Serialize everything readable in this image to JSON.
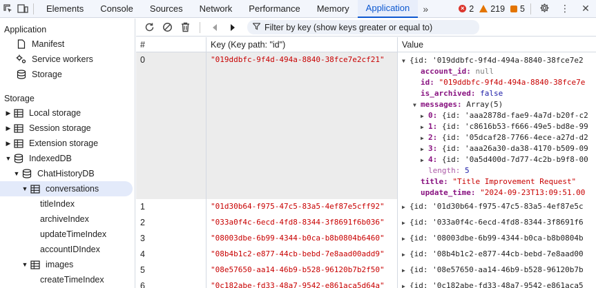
{
  "topbar": {
    "tabs": [
      "Elements",
      "Console",
      "Sources",
      "Network",
      "Performance",
      "Memory",
      "Application"
    ],
    "active_tab": "Application",
    "errors": "2",
    "warnings": "219",
    "issues": "5"
  },
  "sidebar": {
    "app_header": "Application",
    "app_items": [
      "Manifest",
      "Service workers",
      "Storage"
    ],
    "storage_header": "Storage",
    "storage_items": [
      "Local storage",
      "Session storage",
      "Extension storage",
      "IndexedDB"
    ],
    "db_name": "ChatHistoryDB",
    "store_conversations": "conversations",
    "conversation_indexes": [
      "titleIndex",
      "archiveIndex",
      "updateTimeIndex",
      "accountIDIndex"
    ],
    "store_images": "images",
    "image_indexes": [
      "createTimeIndex"
    ]
  },
  "toolbar": {
    "filter_placeholder": "Filter by key (show keys greater or equal to)"
  },
  "table": {
    "col_num": "#",
    "col_key": "Key (Key path: \"id\")",
    "col_value": "Value",
    "expanded": {
      "num": "0",
      "key": "\"019ddbfc-9f4d-494a-8840-38fce7e2cf21\"",
      "summary": "{id: '019ddbfc-9f4d-494a-8840-38fce7e2",
      "account_id_label": "account_id:",
      "account_id_value": "null",
      "id_label": "id:",
      "id_value": "\"019ddbfc-9f4d-494a-8840-38fce7e",
      "is_archived_label": "is_archived:",
      "is_archived_value": "false",
      "messages_label": "messages:",
      "messages_value": "Array(5)",
      "messages": [
        {
          "idx": "0:",
          "text": "{id: 'aaa2878d-fae9-4a7d-b20f-c2"
        },
        {
          "idx": "1:",
          "text": "{id: 'c8616b53-f666-49e5-bd8e-99"
        },
        {
          "idx": "2:",
          "text": "{id: '05dcaf28-7766-4ece-a27d-d2"
        },
        {
          "idx": "3:",
          "text": "{id: 'aaa26a30-da38-4170-b509-09"
        },
        {
          "idx": "4:",
          "text": "{id: '0a5d400d-7d77-4c2b-b9f8-00"
        }
      ],
      "length_label": "length:",
      "length_value": "5",
      "title_label": "title:",
      "title_value": "\"Title Improvement Request\"",
      "update_time_label": "update_time:",
      "update_time_value": "\"2024-09-23T13:09:51.00"
    },
    "rows": [
      {
        "num": "1",
        "key": "\"01d30b64-f975-47c5-83a5-4ef87e5cff92\"",
        "value": "{id: '01d30b64-f975-47c5-83a5-4ef87e5c"
      },
      {
        "num": "2",
        "key": "\"033a0f4c-6ecd-4fd8-8344-3f8691f6b036\"",
        "value": "{id: '033a0f4c-6ecd-4fd8-8344-3f8691f6"
      },
      {
        "num": "3",
        "key": "\"08003dbe-6b99-4344-b0ca-b8b0804b6460\"",
        "value": "{id: '08003dbe-6b99-4344-b0ca-b8b0804b"
      },
      {
        "num": "4",
        "key": "\"08b4b1c2-e877-44cb-bebd-7e8aad00add9\"",
        "value": "{id: '08b4b1c2-e877-44cb-bebd-7e8aad00"
      },
      {
        "num": "5",
        "key": "\"08e57650-aa14-46b9-b528-96120b7b2f50\"",
        "value": "{id: '08e57650-aa14-46b9-b528-96120b7b"
      },
      {
        "num": "6",
        "key": "\"0c182abe-fd33-48a7-9542-e861aca5d64a\"",
        "value": "{id: '0c182abe-fd33-48a7-9542-e861aca5"
      }
    ]
  }
}
